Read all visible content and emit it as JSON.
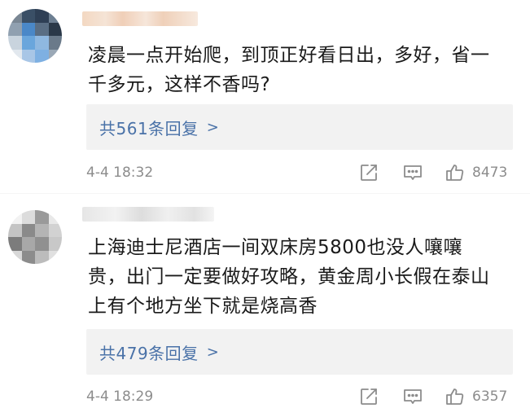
{
  "comments": [
    {
      "lines": [
        "凌晨一点开始爬，到顶正好看日出，多好，省一",
        "千多元，这样不香吗?"
      ],
      "reply_label": "共561条回复",
      "reply_arrow": ">",
      "time": "4-4 18:32",
      "likes": "8473"
    },
    {
      "lines": [
        "上海迪士尼酒店一间双床房5800也没人嚷嚷",
        "贵，出门一定要做好攻略，黄金周小长假在泰山",
        "上有个地方坐下就是烧高香"
      ],
      "reply_label": "共479条回复",
      "reply_arrow": ">",
      "time": "4-4 18:29",
      "likes": "6357"
    }
  ],
  "colors": {
    "reply_link": "#4a72a8",
    "meta_gray": "#8c8c8c",
    "reply_bg": "#f2f2f2"
  },
  "icons": {
    "share": "share-icon",
    "comment": "comment-icon",
    "like": "thumbs-up-icon"
  }
}
